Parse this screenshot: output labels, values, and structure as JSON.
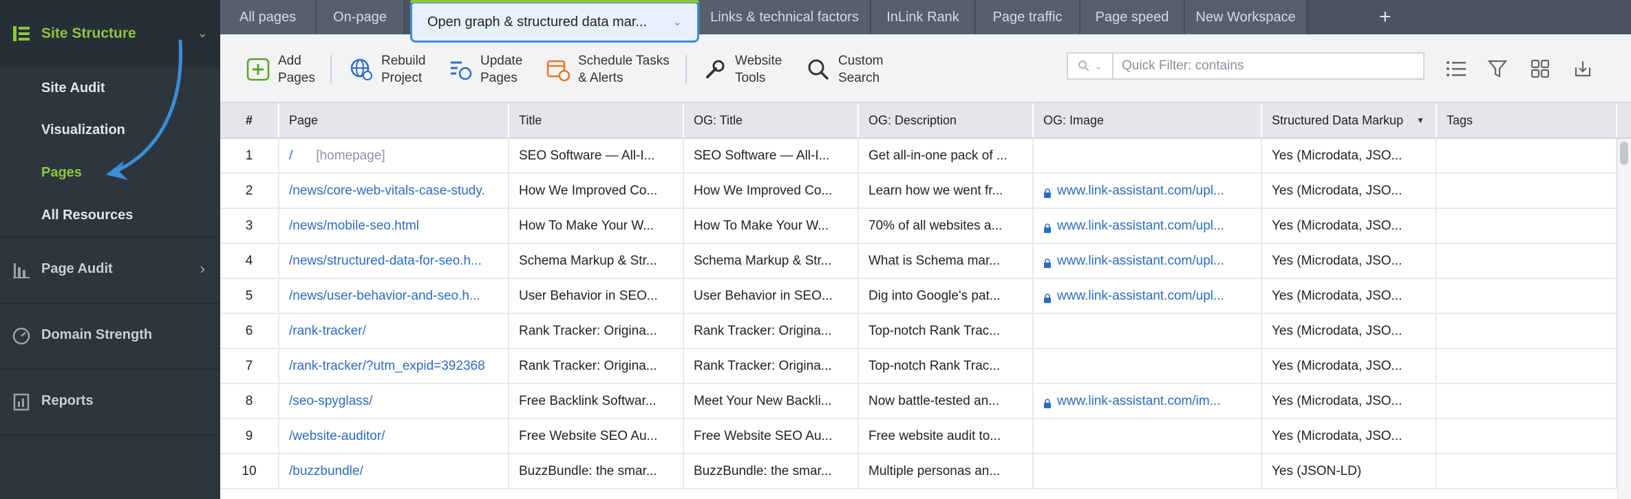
{
  "sidebar": {
    "section_site_structure": "Site Structure",
    "items": [
      "Site Audit",
      "Visualization",
      "Pages",
      "All Resources"
    ],
    "active_item": "Pages",
    "section_page_audit": "Page Audit",
    "section_domain_strength": "Domain Strength",
    "section_reports": "Reports"
  },
  "tabs": [
    "All pages",
    "On-page",
    "Open graph & structured data mar...",
    "Links & technical factors",
    "InLink Rank",
    "Page traffic",
    "Page speed",
    "New Workspace"
  ],
  "toolbar": {
    "add_pages": "Add\nPages",
    "rebuild_project": "Rebuild\nProject",
    "update_pages": "Update\nPages",
    "schedule_tasks": "Schedule Tasks\n& Alerts",
    "website_tools": "Website\nTools",
    "custom_search": "Custom\nSearch",
    "filter_placeholder": "Quick Filter: contains"
  },
  "table": {
    "headers": [
      "#",
      "Page",
      "Title",
      "OG: Title",
      "OG: Description",
      "OG: Image",
      "Structured Data Markup",
      "Tags"
    ],
    "homepage_label": "[homepage]",
    "rows": [
      {
        "n": "1",
        "page": "/",
        "title": "SEO Software — All-I...",
        "og_title": "SEO Software — All-I...",
        "og_desc": "Get all-in-one pack of ...",
        "og_image": "",
        "sdm": "Yes (Microdata, JSO...",
        "tags": ""
      },
      {
        "n": "2",
        "page": "/news/core-web-vitals-case-study.",
        "title": "How We Improved Co...",
        "og_title": "How We Improved Co...",
        "og_desc": "Learn how we went fr...",
        "og_image": "www.link-assistant.com/upl...",
        "sdm": "Yes (Microdata, JSO...",
        "tags": ""
      },
      {
        "n": "3",
        "page": "/news/mobile-seo.html",
        "title": "How To Make Your W...",
        "og_title": "How To Make Your W...",
        "og_desc": "70% of all websites a...",
        "og_image": "www.link-assistant.com/upl...",
        "sdm": "Yes (Microdata, JSO...",
        "tags": ""
      },
      {
        "n": "4",
        "page": "/news/structured-data-for-seo.h...",
        "title": "Schema Markup & Str...",
        "og_title": "Schema Markup & Str...",
        "og_desc": "What is Schema mar...",
        "og_image": "www.link-assistant.com/upl...",
        "sdm": "Yes (Microdata, JSO...",
        "tags": ""
      },
      {
        "n": "5",
        "page": "/news/user-behavior-and-seo.h...",
        "title": "User Behavior in SEO...",
        "og_title": "User Behavior in SEO...",
        "og_desc": "Dig into Google's pat...",
        "og_image": "www.link-assistant.com/upl...",
        "sdm": "Yes (Microdata, JSO...",
        "tags": ""
      },
      {
        "n": "6",
        "page": "/rank-tracker/",
        "title": "Rank Tracker: Origina...",
        "og_title": "Rank Tracker: Origina...",
        "og_desc": "Top-notch Rank Trac...",
        "og_image": "",
        "sdm": "Yes (Microdata, JSO...",
        "tags": ""
      },
      {
        "n": "7",
        "page": "/rank-tracker/?utm_expid=392368",
        "title": "Rank Tracker: Origina...",
        "og_title": "Rank Tracker: Origina...",
        "og_desc": "Top-notch Rank Trac...",
        "og_image": "",
        "sdm": "Yes (Microdata, JSO...",
        "tags": ""
      },
      {
        "n": "8",
        "page": "/seo-spyglass/",
        "title": "Free Backlink Softwar...",
        "og_title": "Meet Your New Backli...",
        "og_desc": "Now battle-tested an...",
        "og_image": "www.link-assistant.com/im...",
        "sdm": "Yes (Microdata, JSO...",
        "tags": ""
      },
      {
        "n": "9",
        "page": "/website-auditor/",
        "title": "Free Website SEO Au...",
        "og_title": "Free Website SEO Au...",
        "og_desc": "Free website audit to...",
        "og_image": "",
        "sdm": "Yes (Microdata, JSO...",
        "tags": ""
      },
      {
        "n": "10",
        "page": "/buzzbundle/",
        "title": "BuzzBundle: the smar...",
        "og_title": "BuzzBundle: the smar...",
        "og_desc": "Multiple personas an...",
        "og_image": "",
        "sdm": "Yes (JSON-LD)",
        "tags": ""
      }
    ]
  },
  "colors": {
    "accent_green": "#8cc63f",
    "link_blue": "#2b6cc0",
    "active_tab_border": "#3a8fd6",
    "annotation_arrow": "#3a8fd6"
  }
}
